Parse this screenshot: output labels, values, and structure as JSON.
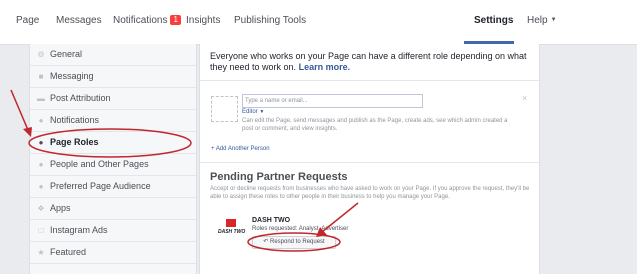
{
  "topnav": {
    "page": "Page",
    "messages": "Messages",
    "notifications": "Notifications",
    "notifications_count": "1",
    "insights": "Insights",
    "publishing_tools": "Publishing Tools",
    "settings": "Settings",
    "help": "Help"
  },
  "sidebar": {
    "items": [
      {
        "label": "General",
        "icon": "gear-icon"
      },
      {
        "label": "Messaging",
        "icon": "speech-bubble-icon"
      },
      {
        "label": "Post Attribution",
        "icon": "flag-icon"
      },
      {
        "label": "Notifications",
        "icon": "globe-icon"
      },
      {
        "label": "Page Roles",
        "icon": "person-icon"
      },
      {
        "label": "People and Other Pages",
        "icon": "people-icon"
      },
      {
        "label": "Preferred Page Audience",
        "icon": "people-icon"
      },
      {
        "label": "Apps",
        "icon": "apps-icon"
      },
      {
        "label": "Instagram Ads",
        "icon": "instagram-icon"
      },
      {
        "label": "Featured",
        "icon": "star-icon"
      }
    ],
    "active_label": "Page Roles"
  },
  "main": {
    "intro_text": "Everyone who works on your Page can have a different role depending on what they need to work on.",
    "learn_more": "Learn more.",
    "name_placeholder": "Type a name or email...",
    "role_select": "Editor",
    "role_description": "Can edit the Page, send messages and publish as the Page, create ads, see which admin created a post or comment, and view insights.",
    "close": "×",
    "add_person": "+ Add Another Person",
    "pending_title": "Pending Partner Requests",
    "pending_description": "Accept or decline requests from businesses who have asked to work on your Page. If you approve the request, they'll be able to assign these roles to other people in their business to help you manage your Page.",
    "partner_name": "DASH TWO",
    "partner_logo_text": "DASH TWO",
    "partner_roles": "Roles requested: Analyst, Advertiser",
    "respond_button": "Respond to Request"
  },
  "colors": {
    "accent": "#4267b2",
    "link": "#365899",
    "annotation": "#c0272d"
  }
}
